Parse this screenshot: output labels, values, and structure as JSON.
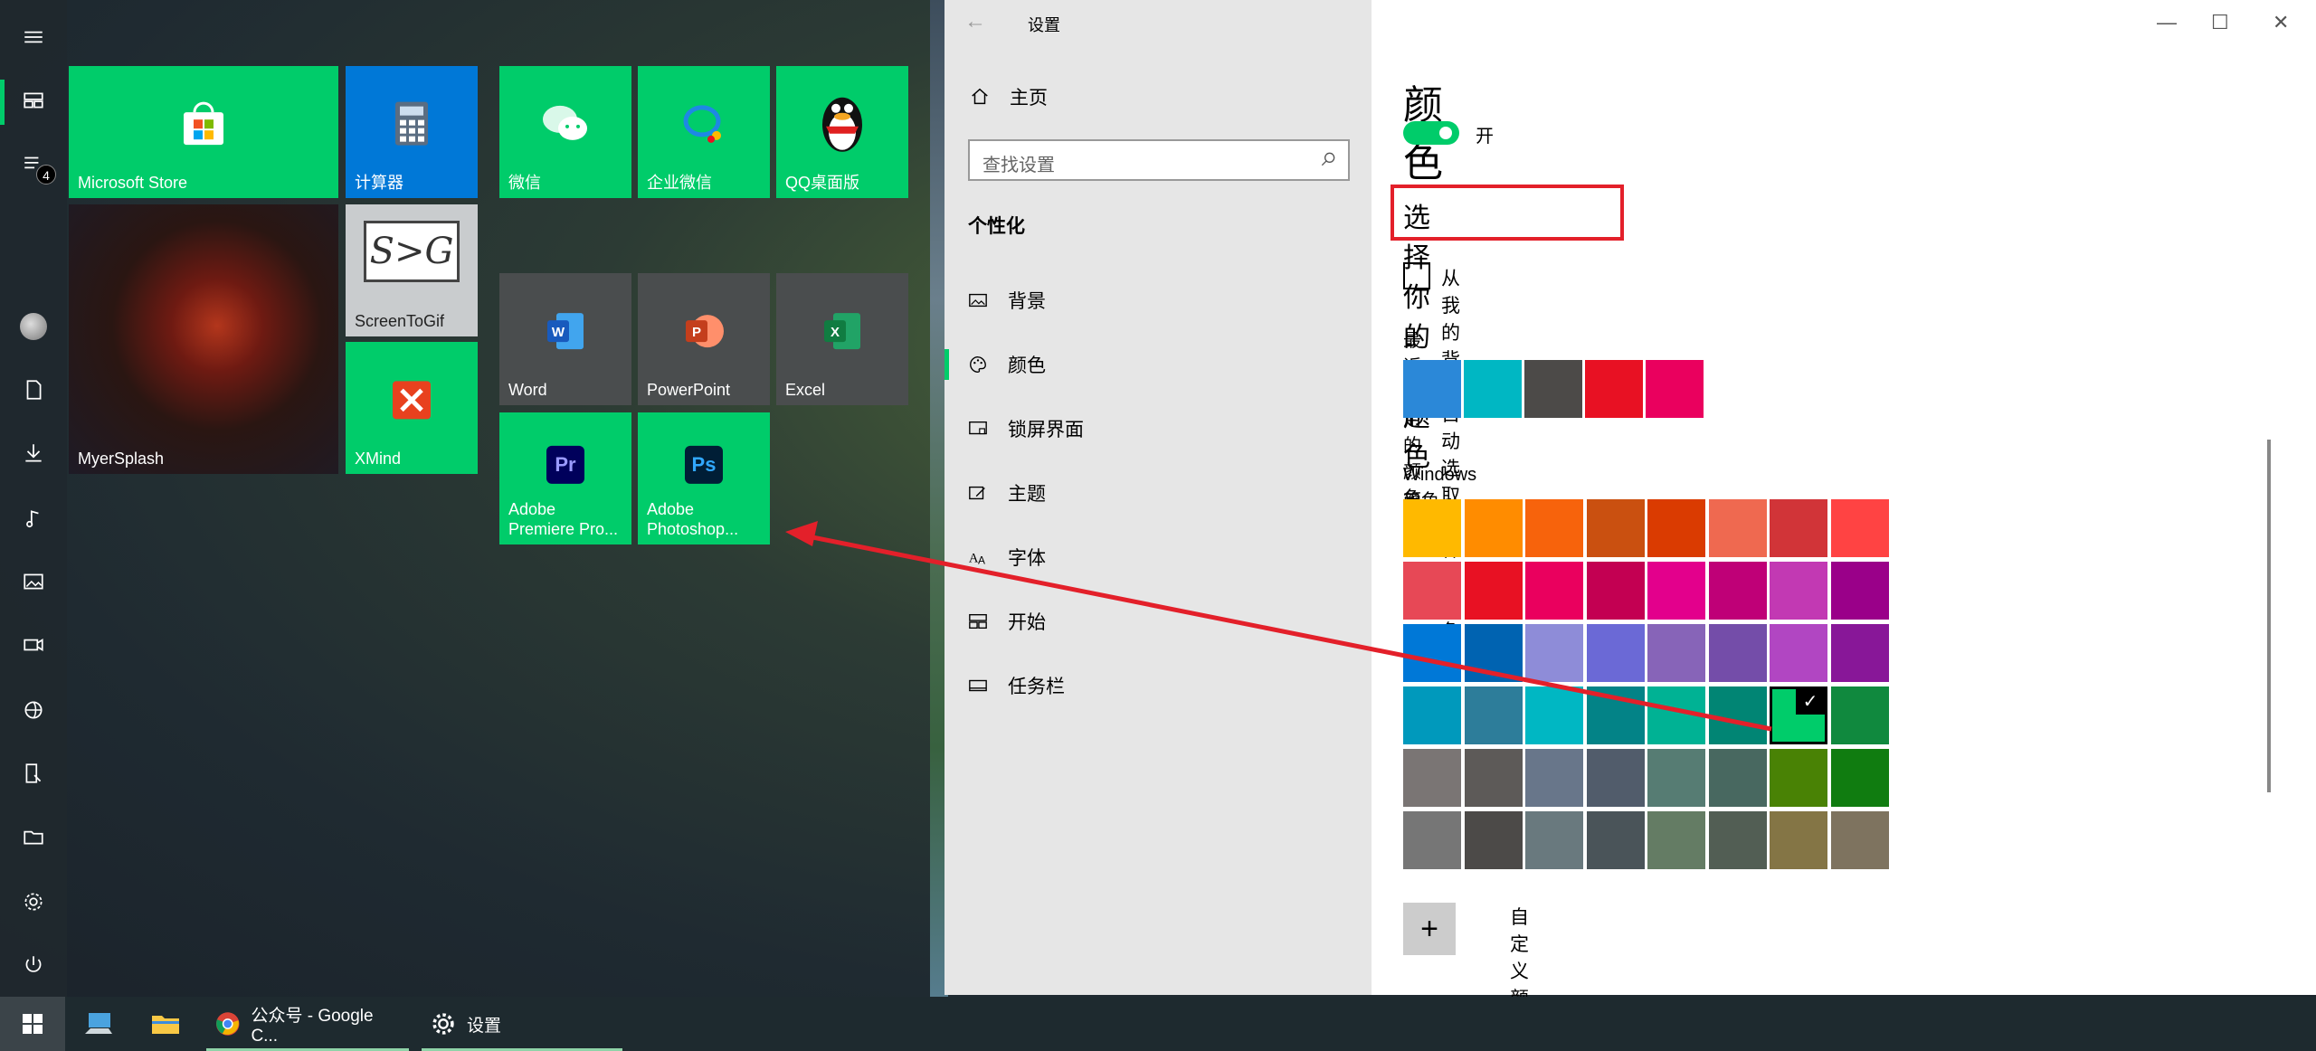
{
  "start_menu": {
    "badge_count": "4",
    "tiles": {
      "microsoft_store": "Microsoft Store",
      "calculator": "计算器",
      "wechat": "微信",
      "wecom": "企业微信",
      "qq": "QQ桌面版",
      "myersplash": "MyerSplash",
      "screentogif": "ScreenToGif",
      "screentogif_logo": "S>G",
      "xmind": "XMind",
      "word": "Word",
      "word_icon_letter": "W",
      "powerpoint": "PowerPoint",
      "powerpoint_icon_letter": "P",
      "excel": "Excel",
      "excel_icon_letter": "X",
      "premiere": "Adobe Premiere Pro...",
      "premiere_icon": "Pr",
      "photoshop": "Adobe Photoshop...",
      "photoshop_icon": "Ps"
    }
  },
  "settings": {
    "window_title": "设置",
    "nav": {
      "home": "主页",
      "search_placeholder": "查找设置",
      "section": "个性化",
      "items": [
        {
          "label": "背景",
          "icon": "picture-icon"
        },
        {
          "label": "颜色",
          "icon": "palette-icon"
        },
        {
          "label": "锁屏界面",
          "icon": "lockscreen-icon"
        },
        {
          "label": "主题",
          "icon": "theme-icon"
        },
        {
          "label": "字体",
          "icon": "font-icon"
        },
        {
          "label": "开始",
          "icon": "start-icon"
        },
        {
          "label": "任务栏",
          "icon": "taskbar-icon"
        }
      ]
    },
    "content": {
      "title": "颜色",
      "toggle_label": "开",
      "choose_accent": "选择你的主题色",
      "auto_pick_label": "从我的背景自动选取一种主题色",
      "recent_label": "最近使用的颜色",
      "recent_colors": [
        "#2b88d8",
        "#00b7c3",
        "#4c4a48",
        "#e81123",
        "#ea005e"
      ],
      "windows_label": "Windows 颜色",
      "windows_colors": [
        [
          "#ffb900",
          "#ff8c00",
          "#f7630c",
          "#ca5010",
          "#da3b01",
          "#ef6950",
          "#d13438",
          "#ff4343"
        ],
        [
          "#e74856",
          "#e81123",
          "#ea005e",
          "#c30052",
          "#e3008c",
          "#bf0077",
          "#c239b3",
          "#9a0089"
        ],
        [
          "#0078d7",
          "#0063b1",
          "#8e8cd8",
          "#6b69d6",
          "#8764b8",
          "#744da9",
          "#b146c2",
          "#881798"
        ],
        [
          "#0099bc",
          "#2d7d9a",
          "#00b7c3",
          "#038387",
          "#00b294",
          "#018574",
          "#00cc6a",
          "#10893e"
        ],
        [
          "#7a7574",
          "#5d5a58",
          "#68768a",
          "#515c6b",
          "#567c73",
          "#486860",
          "#498205",
          "#107c10"
        ],
        [
          "#767676",
          "#4c4a48",
          "#69797e",
          "#4a5459",
          "#647c64",
          "#525e54",
          "#847545",
          "#7e735f"
        ]
      ],
      "selected_color": "#00cc6a",
      "check_mark": "✓",
      "custom_label": "自定义颜色",
      "plus": "+"
    }
  },
  "taskbar": {
    "chrome_label": "公众号 - Google C...",
    "settings_label": "设置"
  },
  "colors": {
    "accent": "#00cc6a",
    "annotation_red": "#e3202a"
  }
}
